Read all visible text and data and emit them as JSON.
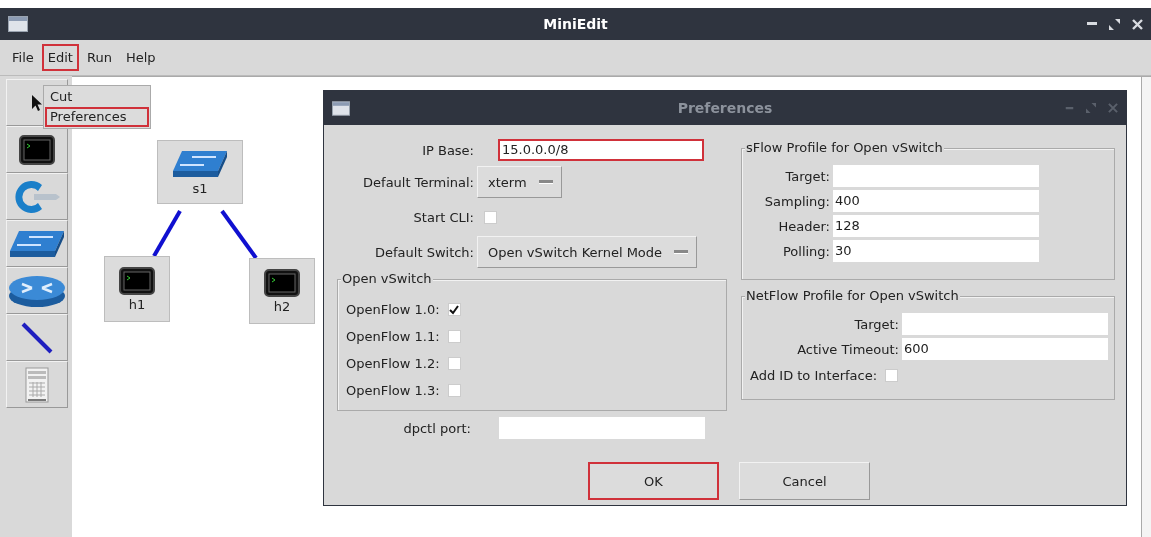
{
  "window": {
    "title": "MiniEdit"
  },
  "menu": [
    {
      "label": "File",
      "highlighted": false
    },
    {
      "label": "Edit",
      "highlighted": true
    },
    {
      "label": "Run",
      "highlighted": false
    },
    {
      "label": "Help",
      "highlighted": false
    }
  ],
  "edit_menu": [
    {
      "label": "Cut",
      "highlighted": false
    },
    {
      "label": "Preferences",
      "highlighted": true
    }
  ],
  "canvas": {
    "nodes": [
      {
        "kind": "switch",
        "label": "s1"
      },
      {
        "kind": "host",
        "label": "h1"
      },
      {
        "kind": "host",
        "label": "h2"
      }
    ]
  },
  "dialog": {
    "title": "Preferences",
    "ip_base": {
      "label": "IP Base:",
      "value": "15.0.0.0/8",
      "highlighted": true
    },
    "default_terminal": {
      "label": "Default Terminal:",
      "value": "xterm"
    },
    "start_cli": {
      "label": "Start CLI:",
      "checked": false
    },
    "default_switch": {
      "label": "Default Switch:",
      "value": "Open vSwitch Kernel Mode"
    },
    "open_vswitch": {
      "title": "Open vSwitch",
      "options": [
        {
          "label": "OpenFlow 1.0:",
          "checked": true
        },
        {
          "label": "OpenFlow 1.1:",
          "checked": false
        },
        {
          "label": "OpenFlow 1.2:",
          "checked": false
        },
        {
          "label": "OpenFlow 1.3:",
          "checked": false
        }
      ]
    },
    "dpctl_port": {
      "label": "dpctl port:"
    },
    "sflow": {
      "title": "sFlow Profile for Open vSwitch",
      "fields": [
        {
          "label": "Target:"
        },
        {
          "label": "Sampling:",
          "value": "400"
        },
        {
          "label": "Header:",
          "value": "128"
        },
        {
          "label": "Polling:",
          "value": "30"
        }
      ]
    },
    "netflow": {
      "title": "NetFlow Profile for Open vSwitch",
      "fields": [
        {
          "label": "Target:"
        },
        {
          "label": "Active Timeout:",
          "value": "600"
        }
      ],
      "add_id": {
        "label": "Add ID to Interface:",
        "checked": false
      }
    },
    "buttons": [
      {
        "label": "OK",
        "highlighted": true
      },
      {
        "label": "Cancel",
        "highlighted": false
      }
    ]
  }
}
